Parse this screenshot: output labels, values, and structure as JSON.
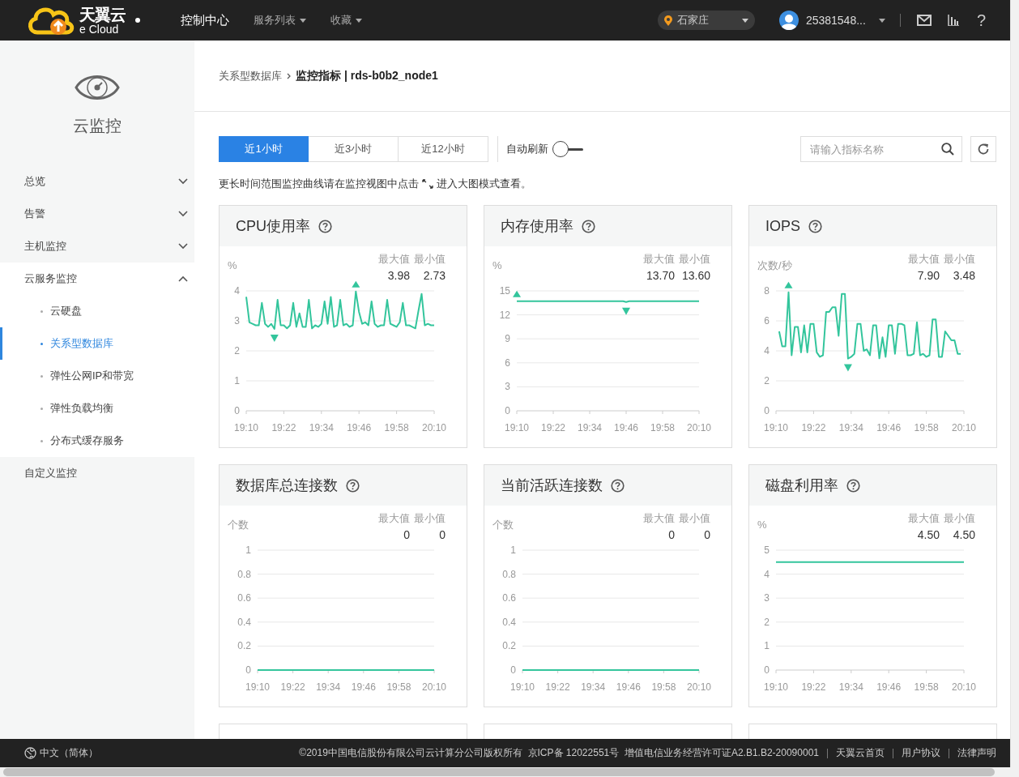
{
  "topbar": {
    "logo": {
      "name": "天翼云",
      "tagline": "e Cloud"
    },
    "nav": [
      {
        "label": "控制中心",
        "selected": true,
        "dropdown": false
      },
      {
        "label": "服务列表",
        "selected": false,
        "dropdown": true
      },
      {
        "label": "收藏",
        "selected": false,
        "dropdown": true
      }
    ],
    "region": {
      "label": "石家庄"
    },
    "user": {
      "name": "25381548..."
    },
    "help": "?"
  },
  "sidebar": {
    "title": "云监控",
    "items": [
      {
        "kind": "group",
        "label": "总览",
        "expanded": false
      },
      {
        "kind": "group",
        "label": "告警",
        "expanded": false
      },
      {
        "kind": "group",
        "label": "主机监控",
        "expanded": false
      },
      {
        "kind": "group",
        "label": "云服务监控",
        "expanded": true,
        "children": [
          {
            "label": "云硬盘",
            "selected": false
          },
          {
            "label": "关系型数据库",
            "selected": true
          },
          {
            "label": "弹性公网IP和带宽",
            "selected": false
          },
          {
            "label": "弹性负载均衡",
            "selected": false
          },
          {
            "label": "分布式缓存服务",
            "selected": false
          }
        ]
      },
      {
        "kind": "link",
        "label": "自定义监控"
      }
    ]
  },
  "main": {
    "breadcrumb": [
      {
        "kind": "link",
        "label": "关系型数据库"
      },
      {
        "kind": "current",
        "label": "监控指标 | rds-b0b2_node1"
      }
    ],
    "toolbar": {
      "time_ranges": [
        {
          "label": "近1小时",
          "selected": true
        },
        {
          "label": "近3小时",
          "selected": false
        },
        {
          "label": "近12小时",
          "selected": false
        }
      ],
      "auto_refresh": {
        "label": "自动刷新",
        "on": false
      },
      "search": {
        "placeholder": "请输入指标名称"
      }
    },
    "hint": {
      "before": "更长时间范围监控曲线请在监控视图中点击",
      "after": "进入大图模式查看。"
    },
    "cards": [
      {
        "title": "CPU使用率",
        "unit": "%",
        "max_label": "最大值",
        "min_label": "最小值",
        "max": "3.98",
        "min": "2.73",
        "chart_data": {
          "type": "line",
          "grid": true,
          "ylim": [
            0,
            4
          ],
          "yticks": [
            0,
            1,
            2,
            3,
            4
          ],
          "categories": [
            "19:10",
            null,
            null,
            null,
            null,
            null,
            null,
            null,
            null,
            null,
            null,
            null,
            "19:22",
            null,
            null,
            null,
            null,
            null,
            null,
            null,
            null,
            null,
            null,
            null,
            "19:34",
            null,
            null,
            null,
            null,
            null,
            null,
            null,
            null,
            null,
            null,
            null,
            "19:46",
            null,
            null,
            null,
            null,
            null,
            null,
            null,
            null,
            null,
            null,
            null,
            "19:58",
            null,
            null,
            null,
            null,
            null,
            null,
            null,
            null,
            null,
            null,
            null,
            "20:10"
          ],
          "series": [
            {
              "color": "#33c59c",
              "values": [
                3.8,
                2.95,
                2.9,
                2.85,
                2.85,
                3.6,
                2.9,
                2.8,
                2.9,
                2.73,
                3.7,
                2.85,
                2.85,
                2.75,
                2.85,
                3.6,
                2.8,
                3.25,
                2.8,
                2.8,
                3.7,
                2.75,
                2.85,
                2.8,
                2.9,
                3.65,
                2.9,
                3.8,
                2.8,
                2.85,
                3.7,
                2.85,
                2.9,
                2.8,
                2.85,
                3.98,
                3.3,
                2.9,
                2.95,
                2.85,
                3.65,
                2.9,
                2.8,
                2.85,
                2.85,
                3.7,
                2.9,
                2.85,
                2.8,
                2.95,
                3.6,
                2.85,
                2.85,
                2.8,
                2.75,
                3.35,
                3.9,
                2.85,
                2.9,
                2.85,
                2.85
              ]
            }
          ]
        }
      },
      {
        "title": "内存使用率",
        "unit": "%",
        "max_label": "最大值",
        "min_label": "最小值",
        "max": "13.70",
        "min": "13.60",
        "chart_data": {
          "type": "line",
          "grid": true,
          "ylim": [
            0,
            15
          ],
          "yticks": [
            0,
            3,
            6,
            9,
            12,
            15
          ],
          "categories": [
            "19:10",
            null,
            null,
            null,
            null,
            null,
            null,
            null,
            null,
            null,
            null,
            null,
            "19:22",
            null,
            null,
            null,
            null,
            null,
            null,
            null,
            null,
            null,
            null,
            null,
            "19:34",
            null,
            null,
            null,
            null,
            null,
            null,
            null,
            null,
            null,
            null,
            null,
            "19:46",
            null,
            null,
            null,
            null,
            null,
            null,
            null,
            null,
            null,
            null,
            null,
            "19:58",
            null,
            null,
            null,
            null,
            null,
            null,
            null,
            null,
            null,
            null,
            null,
            "20:10"
          ],
          "series": [
            {
              "color": "#33c59c",
              "values": [
                13.7,
                13.7,
                13.7,
                13.7,
                13.7,
                13.7,
                13.7,
                13.7,
                13.7,
                13.7,
                13.7,
                13.7,
                13.7,
                13.7,
                13.7,
                13.7,
                13.7,
                13.7,
                13.7,
                13.7,
                13.7,
                13.7,
                13.7,
                13.7,
                13.7,
                13.7,
                13.7,
                13.7,
                13.7,
                13.7,
                13.7,
                13.7,
                13.7,
                13.7,
                13.7,
                13.7,
                13.6,
                13.7,
                13.7,
                13.7,
                13.7,
                13.7,
                13.7,
                13.7,
                13.7,
                13.7,
                13.7,
                13.7,
                13.7,
                13.7,
                13.7,
                13.7,
                13.7,
                13.7,
                13.7,
                13.7,
                13.7,
                13.7,
                13.7,
                13.7,
                13.7
              ]
            }
          ]
        }
      },
      {
        "title": "IOPS",
        "unit": "次数/秒",
        "max_label": "最大值",
        "min_label": "最小值",
        "max": "7.90",
        "min": "3.48",
        "chart_data": {
          "type": "line",
          "grid": true,
          "ylim": [
            0,
            8
          ],
          "yticks": [
            0,
            2,
            4,
            6,
            8
          ],
          "categories": [
            "19:10",
            null,
            null,
            null,
            null,
            null,
            null,
            null,
            null,
            null,
            null,
            null,
            "19:22",
            null,
            null,
            null,
            null,
            null,
            null,
            null,
            null,
            null,
            null,
            null,
            "19:34",
            null,
            null,
            null,
            null,
            null,
            null,
            null,
            null,
            null,
            null,
            null,
            "19:46",
            null,
            null,
            null,
            null,
            null,
            null,
            null,
            null,
            null,
            null,
            null,
            "19:58",
            null,
            null,
            null,
            null,
            null,
            null,
            null,
            null,
            null,
            null,
            null,
            "20:10"
          ],
          "series": [
            {
              "color": "#33c59c",
              "values": [
                null,
                5.3,
                4.3,
                4.3,
                7.9,
                3.7,
                5.6,
                5.6,
                3.9,
                5.7,
                3.9,
                5.8,
                5.8,
                3.9,
                3.6,
                3.7,
                6.6,
                6.6,
                6.9,
                6.9,
                5.0,
                7.8,
                7.8,
                3.48,
                3.6,
                3.8,
                5.8,
                5.8,
                4.0,
                4.1,
                3.7,
                5.7,
                5.7,
                3.5,
                4.9,
                3.6,
                5.7,
                5.7,
                3.8,
                5.8,
                5.8,
                5.7,
                3.7,
                3.7,
                3.8,
                5.9,
                3.7,
                3.8,
                3.6,
                3.7,
                6.1,
                6.1,
                3.6,
                3.6,
                5.3,
                5.0,
                4.7,
                4.7,
                3.8,
                3.8,
                null
              ]
            }
          ]
        }
      },
      {
        "title": "数据库总连接数",
        "unit": "个数",
        "max_label": "最大值",
        "min_label": "最小值",
        "max": "0",
        "min": "0",
        "chart_data": {
          "type": "line",
          "grid": true,
          "ylim": [
            0,
            1
          ],
          "yticks": [
            0,
            0.2,
            0.4,
            0.6,
            0.8,
            1
          ],
          "categories": [
            "19:10",
            null,
            null,
            null,
            null,
            null,
            null,
            null,
            null,
            null,
            null,
            null,
            "19:22",
            null,
            null,
            null,
            null,
            null,
            null,
            null,
            null,
            null,
            null,
            null,
            "19:34",
            null,
            null,
            null,
            null,
            null,
            null,
            null,
            null,
            null,
            null,
            null,
            "19:46",
            null,
            null,
            null,
            null,
            null,
            null,
            null,
            null,
            null,
            null,
            null,
            "19:58",
            null,
            null,
            null,
            null,
            null,
            null,
            null,
            null,
            null,
            null,
            null,
            "20:10"
          ],
          "series": [
            {
              "color": "#33c59c",
              "values": [
                0,
                0,
                0,
                0,
                0,
                0,
                0,
                0,
                0,
                0,
                0,
                0,
                0,
                0,
                0,
                0,
                0,
                0,
                0,
                0,
                0,
                0,
                0,
                0,
                0,
                0,
                0,
                0,
                0,
                0,
                0,
                0,
                0,
                0,
                0,
                0,
                0,
                0,
                0,
                0,
                0,
                0,
                0,
                0,
                0,
                0,
                0,
                0,
                0,
                0,
                0,
                0,
                0,
                0,
                0,
                0,
                0,
                0,
                0,
                0,
                0
              ]
            }
          ]
        }
      },
      {
        "title": "当前活跃连接数",
        "unit": "个数",
        "max_label": "最大值",
        "min_label": "最小值",
        "max": "0",
        "min": "0",
        "chart_data": {
          "type": "line",
          "grid": true,
          "ylim": [
            0,
            1
          ],
          "yticks": [
            0,
            0.2,
            0.4,
            0.6,
            0.8,
            1
          ],
          "categories": [
            "19:10",
            null,
            null,
            null,
            null,
            null,
            null,
            null,
            null,
            null,
            null,
            null,
            "19:22",
            null,
            null,
            null,
            null,
            null,
            null,
            null,
            null,
            null,
            null,
            null,
            "19:34",
            null,
            null,
            null,
            null,
            null,
            null,
            null,
            null,
            null,
            null,
            null,
            "19:46",
            null,
            null,
            null,
            null,
            null,
            null,
            null,
            null,
            null,
            null,
            null,
            "19:58",
            null,
            null,
            null,
            null,
            null,
            null,
            null,
            null,
            null,
            null,
            null,
            "20:10"
          ],
          "series": [
            {
              "color": "#33c59c",
              "values": [
                0,
                0,
                0,
                0,
                0,
                0,
                0,
                0,
                0,
                0,
                0,
                0,
                0,
                0,
                0,
                0,
                0,
                0,
                0,
                0,
                0,
                0,
                0,
                0,
                0,
                0,
                0,
                0,
                0,
                0,
                0,
                0,
                0,
                0,
                0,
                0,
                0,
                0,
                0,
                0,
                0,
                0,
                0,
                0,
                0,
                0,
                0,
                0,
                0,
                0,
                0,
                0,
                0,
                0,
                0,
                0,
                0,
                0,
                0,
                0,
                0
              ]
            }
          ]
        }
      },
      {
        "title": "磁盘利用率",
        "unit": "%",
        "max_label": "最大值",
        "min_label": "最小值",
        "max": "4.50",
        "min": "4.50",
        "chart_data": {
          "type": "line",
          "grid": true,
          "ylim": [
            0,
            5
          ],
          "yticks": [
            0,
            1,
            2,
            3,
            4,
            5
          ],
          "categories": [
            "19:10",
            null,
            null,
            null,
            null,
            null,
            null,
            null,
            null,
            null,
            null,
            null,
            "19:22",
            null,
            null,
            null,
            null,
            null,
            null,
            null,
            null,
            null,
            null,
            null,
            "19:34",
            null,
            null,
            null,
            null,
            null,
            null,
            null,
            null,
            null,
            null,
            null,
            "19:46",
            null,
            null,
            null,
            null,
            null,
            null,
            null,
            null,
            null,
            null,
            null,
            "19:58",
            null,
            null,
            null,
            null,
            null,
            null,
            null,
            null,
            null,
            null,
            null,
            "20:10"
          ],
          "series": [
            {
              "color": "#33c59c",
              "values": [
                4.5,
                4.5,
                4.5,
                4.5,
                4.5,
                4.5,
                4.5,
                4.5,
                4.5,
                4.5,
                4.5,
                4.5,
                4.5,
                4.5,
                4.5,
                4.5,
                4.5,
                4.5,
                4.5,
                4.5,
                4.5,
                4.5,
                4.5,
                4.5,
                4.5,
                4.5,
                4.5,
                4.5,
                4.5,
                4.5,
                4.5,
                4.5,
                4.5,
                4.5,
                4.5,
                4.5,
                4.5,
                4.5,
                4.5,
                4.5,
                4.5,
                4.5,
                4.5,
                4.5,
                4.5,
                4.5,
                4.5,
                4.5,
                4.5,
                4.5,
                4.5,
                4.5,
                4.5,
                4.5,
                4.5,
                4.5,
                4.5,
                4.5,
                4.5,
                4.5,
                4.5
              ]
            }
          ]
        }
      }
    ]
  },
  "footer": {
    "language": "中文（简体）",
    "copyright": "©2019中国电信股份有限公司云计算分公司版权所有  京ICP备 12022551号  增值电信业务经营许可证A2.B1.B2-20090001",
    "links": [
      "天翼云首页",
      "用户协议",
      "法律声明"
    ]
  }
}
